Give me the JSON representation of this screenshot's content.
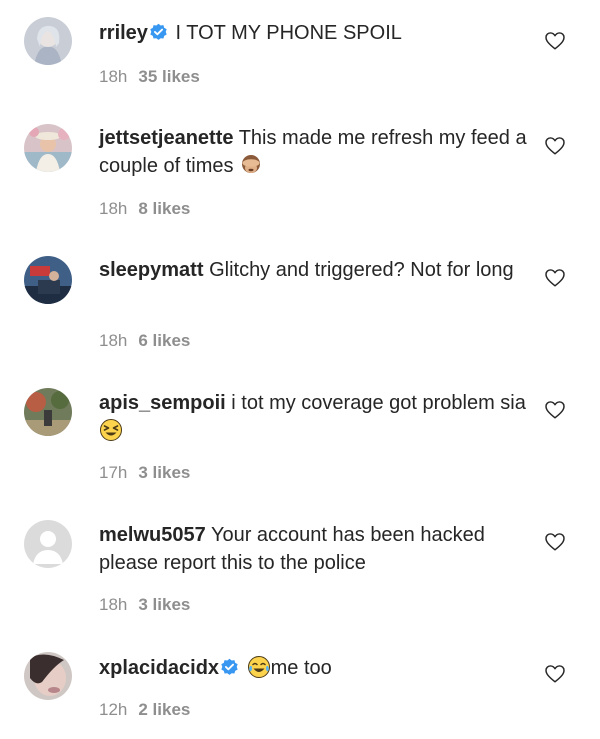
{
  "comments": [
    {
      "username": "rriley",
      "verified": true,
      "text": "I TOT MY PHONE SPOIL",
      "text_after": "",
      "emoji": "",
      "time": "18h",
      "likes": "35 likes"
    },
    {
      "username": "jettsetjeanette",
      "verified": false,
      "text": "This made me refresh my feed a couple of times",
      "text_after": "",
      "emoji": "see-no-evil-monkey",
      "time": "18h",
      "likes": "8 likes"
    },
    {
      "username": "sleepymatt",
      "verified": false,
      "text": "Glitchy and triggered? Not for long",
      "text_after": "",
      "emoji": "",
      "time": "18h",
      "likes": "6 likes"
    },
    {
      "username": "apis_sempoii",
      "verified": false,
      "text": "i tot my coverage got problem sia",
      "text_after": "",
      "emoji": "squinting-face",
      "time": "17h",
      "likes": "3 likes"
    },
    {
      "username": "melwu5057",
      "verified": false,
      "text": "Your account has been hacked please report this to the police",
      "text_after": "",
      "emoji": "",
      "time": "18h",
      "likes": "3 likes"
    },
    {
      "username": "xplacidacidx",
      "verified": true,
      "text": "",
      "text_after": "me too",
      "emoji": "tears-of-joy-face",
      "time": "12h",
      "likes": "2 likes"
    }
  ],
  "colors": {
    "verified_badge": "#3897f0",
    "meta_text": "#8e8e8e",
    "text": "#262626"
  }
}
